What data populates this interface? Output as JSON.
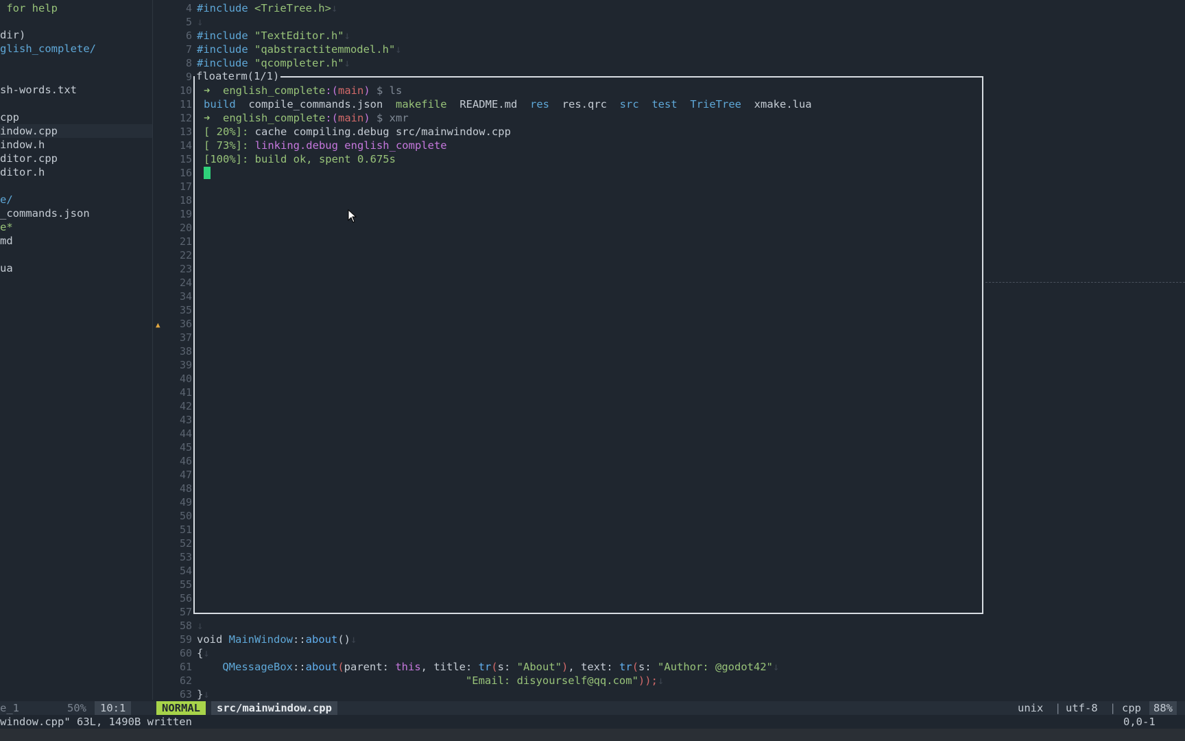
{
  "tree": {
    "help": " for help",
    "dir_root": "dir)",
    "project": "glish_complete/",
    "words": "sh-words.txt",
    "cpp": "cpp",
    "mainwindow_cpp": "indow.cpp",
    "mainwindow_h": "indow.h",
    "texteditor_cpp": "ditor.cpp",
    "texteditor_h": "ditor.h",
    "trietree_dir": "e/",
    "compile_cmds": "_commands.json",
    "exec": "e*",
    "readme": "md",
    "xmake": "ua"
  },
  "line_numbers_top": [
    "4",
    "5",
    "6",
    "7",
    "8",
    "9",
    "10",
    "11",
    "12",
    "13",
    "14",
    "15",
    "16",
    "17",
    "18",
    "19",
    "20",
    "21",
    "22",
    "23",
    "24",
    "34",
    "35",
    "36",
    "37",
    "38",
    "39",
    "40",
    "41",
    "42",
    "43",
    "44",
    "45",
    "46",
    "47",
    "48",
    "49",
    "50",
    "51",
    "52",
    "53",
    "54",
    "55",
    "56",
    "57",
    "58",
    "59",
    "60",
    "61",
    "62",
    "63"
  ],
  "code": {
    "l4_kw": "#include",
    "l4_str": " <TrieTree.h>",
    "l6_kw": "#include",
    "l6_str": " \"TextEditor.h\"",
    "l7_kw": "#include",
    "l7_str": " \"qabstractitemmodel.h\"",
    "l8_kw": "#include",
    "l8_str": " \"qcompleter.h\"",
    "eol": "↓",
    "l59_void": "void ",
    "l59_cls": "MainWindow",
    "l59_sep": "::",
    "l59_fn": "about",
    "l59_par": "()",
    "l60": "{",
    "l61_cls": "QMessageBox",
    "l61_sep": "::",
    "l61_fn": "about",
    "l61_open": "(",
    "l61_p1": "parent: ",
    "l61_this": "this",
    "l61_c1": ", ",
    "l61_p2": "title: ",
    "l61_tr1": "tr",
    "l61_o2": "(",
    "l61_s1": "s: ",
    "l61_str1": "\"About\"",
    "l61_cl2": ")",
    "l61_c2": ", ",
    "l61_p3": "text: ",
    "l61_tr2": "tr",
    "l61_o3": "(",
    "l61_s2": "s: ",
    "l61_str2": "\"Author: @godot42\"",
    "l62_str": "\"Email: disyourself@qq.com\"",
    "l62_end": "));",
    "l63": "}"
  },
  "floaterm": {
    "title": "floaterm(1/1)",
    "arrow": "➜",
    "cwd": "english_complete",
    "branch_pre": ":(",
    "branch": "main",
    "branch_post": ")",
    "prompt": " $ ",
    "cmd1": "ls",
    "ls": {
      "build": "build",
      "compile": "compile_commands.json",
      "makefile": "makefile",
      "readme": "README.md",
      "res": "res",
      "resqrc": "res.qrc",
      "src": "src",
      "test": "test",
      "trietree": "TrieTree",
      "xmake": "xmake.lua"
    },
    "cmd2": "xmr",
    "out1_pct": "[ 20%]: ",
    "out1_txt": "cache compiling.debug src/mainwindow.cpp",
    "out2_pct": "[ 73%]: ",
    "out2_txt": "linking.debug english_complete",
    "out3_pct": "[100%]: ",
    "out3_txt": "build ok, spent 0.675s"
  },
  "status": {
    "left_name": "e_1",
    "left_pct": "50%",
    "left_pos": "10:1",
    "mode": "NORMAL",
    "file": "src/mainwindow.cpp",
    "format": "unix",
    "sep1": "|",
    "encoding": "utf-8",
    "sep2": "|",
    "filetype": "cpp",
    "percent": "88%"
  },
  "message": {
    "text": "window.cpp\" 63L, 1490B written",
    "position": "0,0-1"
  },
  "colors": {
    "background": "#1f262f",
    "mode_bg": "#a8d44a",
    "cursor": "#2fd27a"
  }
}
